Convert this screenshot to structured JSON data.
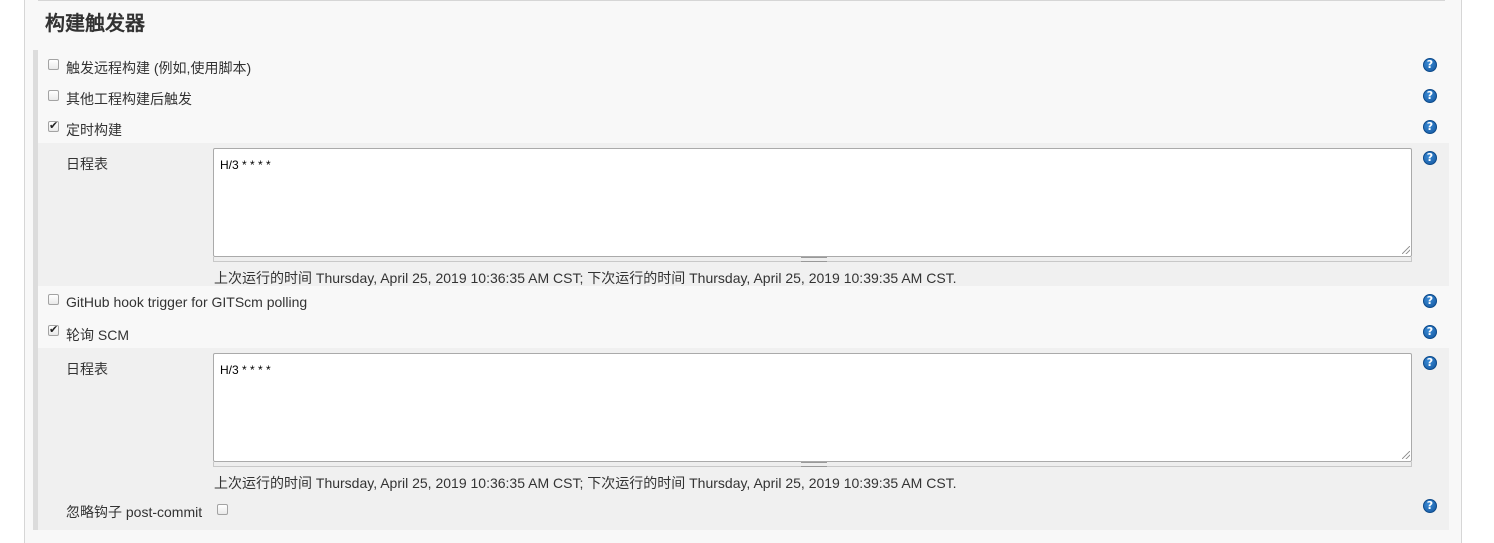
{
  "section": {
    "title": "构建触发器"
  },
  "triggers": {
    "remote": {
      "label": "触发远程构建 (例如,使用脚本)",
      "checked": false
    },
    "after_other": {
      "label": "其他工程构建后触发",
      "checked": false
    },
    "periodic": {
      "label": "定时构建",
      "checked": true,
      "schedule_label": "日程表",
      "schedule_value": "H/3 * * * *",
      "info": "上次运行的时间 Thursday, April 25, 2019 10:36:35 AM CST; 下次运行的时间 Thursday, April 25, 2019 10:39:35 AM CST."
    },
    "github_hook": {
      "label": "GitHub hook trigger for GITScm polling",
      "checked": false
    },
    "poll_scm": {
      "label": "轮询 SCM",
      "checked": true,
      "schedule_label": "日程表",
      "schedule_value": "H/3 * * * *",
      "info": "上次运行的时间 Thursday, April 25, 2019 10:36:35 AM CST; 下次运行的时间 Thursday, April 25, 2019 10:39:35 AM CST.",
      "ignore_hook_label": "忽略钩子 post-commit",
      "ignore_hook_checked": false
    }
  },
  "help": {
    "glyph": "?"
  }
}
